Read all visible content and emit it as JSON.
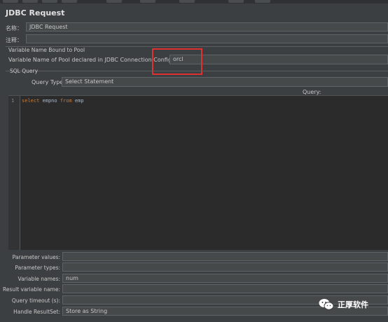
{
  "header": {
    "title": "JDBC Request"
  },
  "name_row": {
    "label": "名称：",
    "value": "JDBC Request"
  },
  "comment_row": {
    "label": "注释：",
    "value": ""
  },
  "pool_section": {
    "title": "Variable Name Bound to Pool",
    "label": "Variable Name of Pool declared in JDBC Connection Configuration:",
    "value": "orcl"
  },
  "sql_section": {
    "title": "SQL Query",
    "query_type_label": "Query Type:",
    "query_type_value": "Select Statement",
    "query_header": "Query:"
  },
  "editor": {
    "line_number": "1",
    "code": {
      "kw1": "select",
      "t1": " empno ",
      "kw2": "from",
      "t2": " emp"
    }
  },
  "params": {
    "parameter_values_label": "Parameter values:",
    "parameter_values_value": "",
    "parameter_types_label": "Parameter types:",
    "parameter_types_value": "",
    "variable_names_label": "Variable names:",
    "variable_names_value": "num",
    "result_variable_label": "Result variable name:",
    "result_variable_value": "",
    "query_timeout_label": "Query timeout (s):",
    "query_timeout_value": "",
    "handle_resultset_label": "Handle ResultSet:",
    "handle_resultset_value": "Store as String"
  },
  "watermark": {
    "text": "正厚软件",
    "icon": "wechat-icon"
  },
  "colors": {
    "background": "#3c3f41",
    "editor_bg": "#2b2b2b",
    "keyword": "#cc7832",
    "highlight_box": "#e03030"
  }
}
